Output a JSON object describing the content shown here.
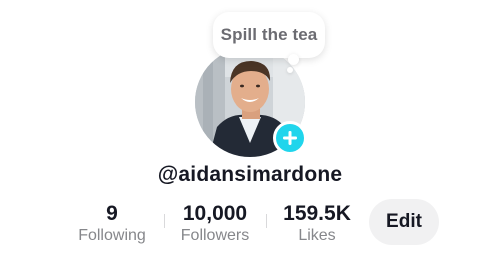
{
  "bubble": {
    "text": "Spill the tea"
  },
  "profile": {
    "username": "@aidansimardone",
    "add_icon": "plus-icon"
  },
  "stats": [
    {
      "value": "9",
      "label": "Following"
    },
    {
      "value": "10,000",
      "label": "Followers"
    },
    {
      "value": "159.5K",
      "label": "Likes"
    }
  ],
  "actions": {
    "edit_label": "Edit"
  },
  "colors": {
    "accent": "#20d5ec",
    "text": "#161823",
    "muted": "#86878b",
    "button_bg": "#f1f1f2"
  }
}
